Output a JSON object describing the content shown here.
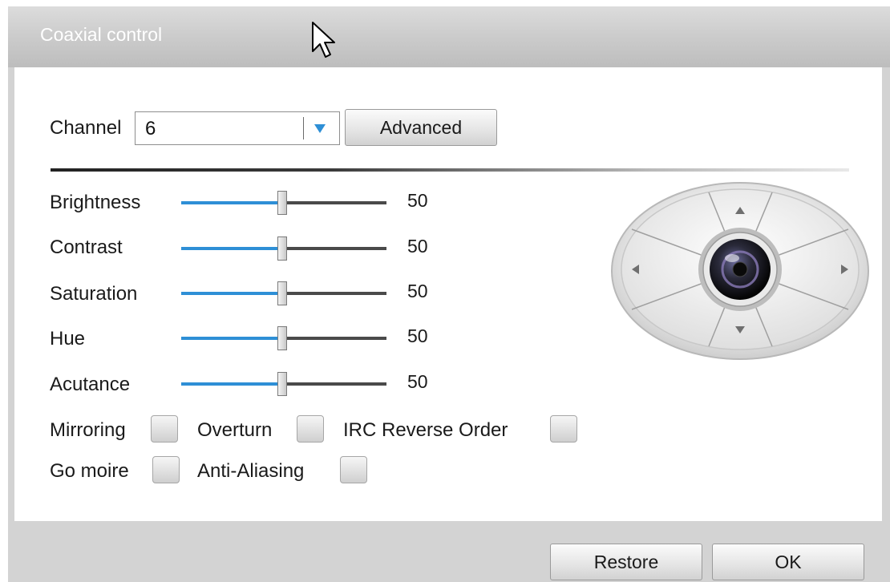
{
  "dialog": {
    "title": "Coaxial control"
  },
  "channel": {
    "label": "Channel",
    "value": "6"
  },
  "buttons": {
    "advanced": "Advanced",
    "restore": "Restore",
    "ok": "OK"
  },
  "sliders": [
    {
      "label": "Brightness",
      "value": "50",
      "level": 50
    },
    {
      "label": "Contrast",
      "value": "50",
      "level": 50
    },
    {
      "label": "Saturation",
      "value": "50",
      "level": 50
    },
    {
      "label": "Hue",
      "value": "50",
      "level": 50
    },
    {
      "label": "Acutance",
      "value": "50",
      "level": 50
    }
  ],
  "checkboxes": {
    "mirroring": {
      "label": "Mirroring",
      "checked": false
    },
    "overturn": {
      "label": "Overturn",
      "checked": false
    },
    "irc_reverse": {
      "label": "IRC Reverse Order",
      "checked": false
    },
    "go_moire": {
      "label": "Go moire",
      "checked": false
    },
    "anti_aliasing": {
      "label": "Anti-Aliasing",
      "checked": false
    }
  },
  "colors": {
    "accent": "#2e8fd6",
    "panel": "#d3d3d3",
    "content": "#ffffff"
  },
  "icons": [
    "dropdown-arrow-icon",
    "ptz-up-icon",
    "ptz-down-icon",
    "ptz-left-icon",
    "ptz-right-icon",
    "camera-lens-icon",
    "mouse-cursor-icon"
  ]
}
